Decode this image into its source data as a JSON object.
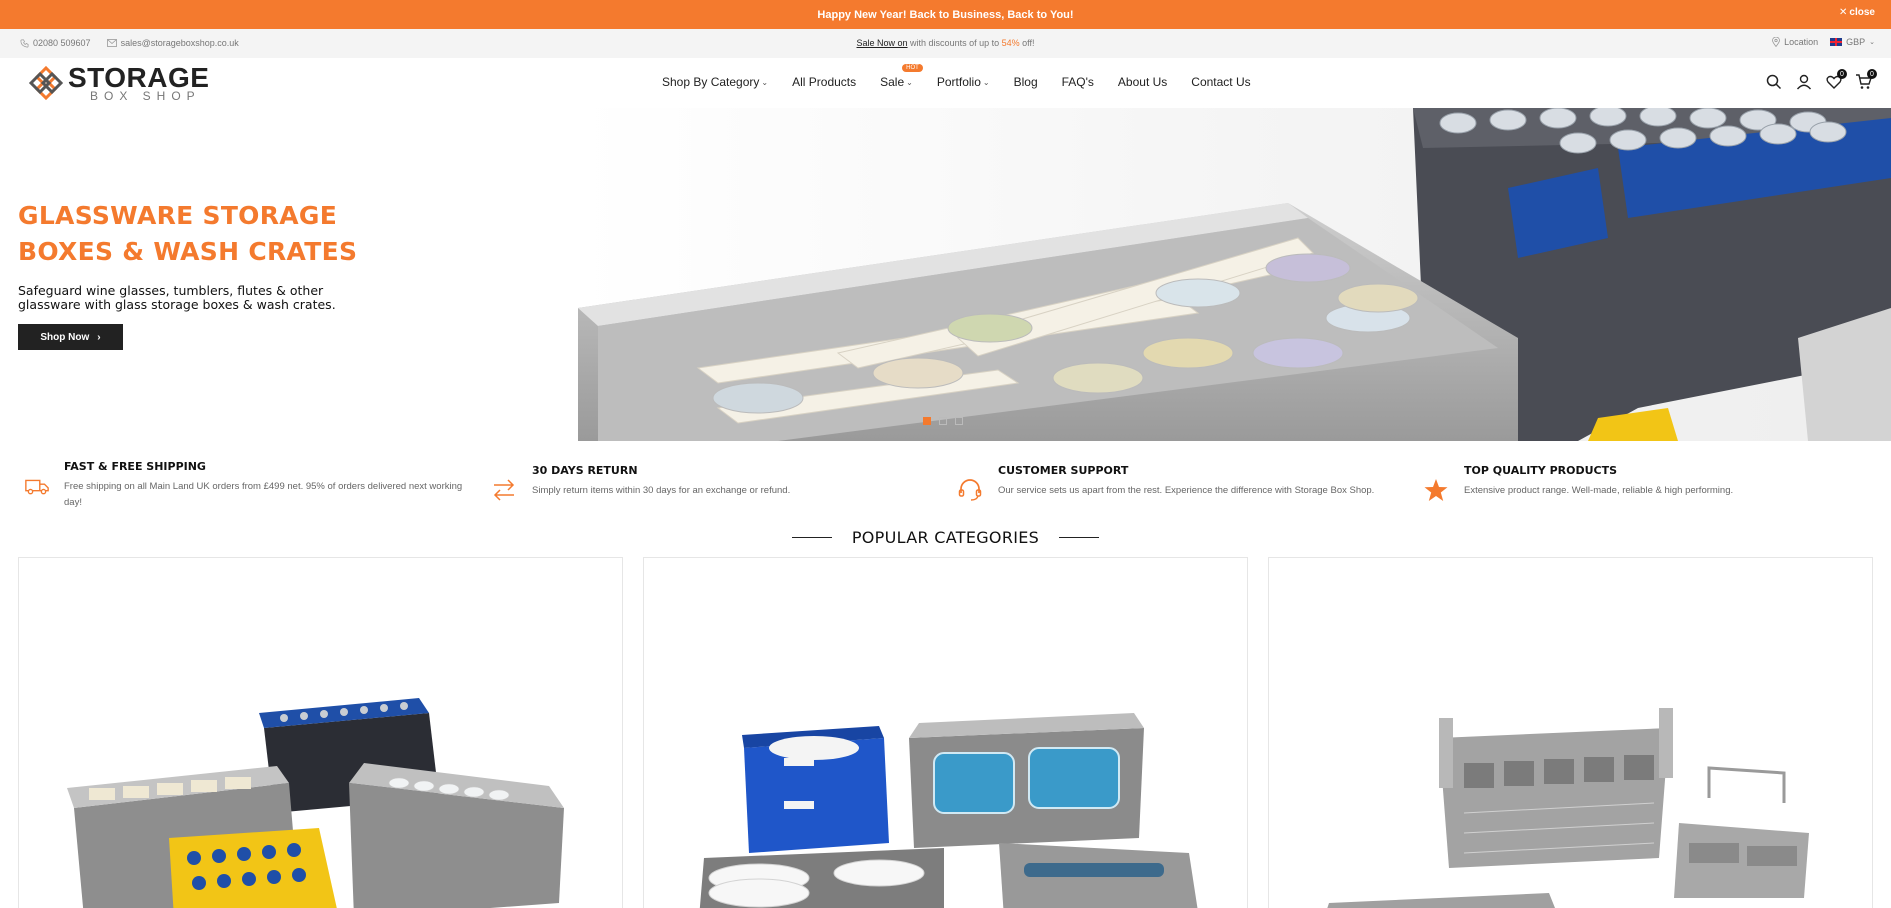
{
  "announcement": {
    "message": "Happy New Year! Back to Business, Back to You!",
    "close_label": "close"
  },
  "topbar": {
    "phone": "02080 509607",
    "email": "sales@storageboxshop.co.uk",
    "promo_link": "Sale Now on",
    "promo_text_1": " with discounts of up to ",
    "promo_percent": "54%",
    "promo_text_2": " off!",
    "location_label": "Location",
    "currency_label": "GBP"
  },
  "header": {
    "logo_main": "STORAGE",
    "logo_sub": "BOX SHOP",
    "nav": [
      {
        "label": "Shop By Category",
        "dropdown": true
      },
      {
        "label": "All Products",
        "dropdown": false
      },
      {
        "label": "Sale",
        "dropdown": true,
        "badge": "HOT"
      },
      {
        "label": "Portfolio",
        "dropdown": true
      },
      {
        "label": "Blog",
        "dropdown": false
      },
      {
        "label": "FAQ's",
        "dropdown": false
      },
      {
        "label": "About Us",
        "dropdown": false
      },
      {
        "label": "Contact Us",
        "dropdown": false
      }
    ],
    "wishlist_count": "0",
    "cart_count": "0"
  },
  "hero": {
    "title_line1": "GLASSWARE STORAGE",
    "title_line2": "BOXES & WASH CRATES",
    "subtitle": "Safeguard wine glasses, tumblers, flutes & other glassware with glass storage boxes & wash crates.",
    "button_label": "Shop Now",
    "slides_total": 3,
    "active_slide": 1
  },
  "features": [
    {
      "icon": "truck-icon",
      "title": "FAST & FREE SHIPPING",
      "desc": "Free shipping on all Main Land UK orders from £499 net. 95% of orders delivered next working day!"
    },
    {
      "icon": "return-arrows-icon",
      "title": "30 DAYS RETURN",
      "desc": "Simply return items within 30 days for an exchange or refund."
    },
    {
      "icon": "headset-icon",
      "title": "CUSTOMER SUPPORT",
      "desc": "Our service sets us apart from the rest. Experience the difference with Storage Box Shop."
    },
    {
      "icon": "star-icon",
      "title": "TOP QUALITY PRODUCTS",
      "desc": "Extensive product range. Well-made, reliable & high performing."
    }
  ],
  "popular_categories": {
    "heading": "POPULAR CATEGORIES"
  },
  "colors": {
    "accent": "#f47a2e",
    "dark": "#222222"
  }
}
